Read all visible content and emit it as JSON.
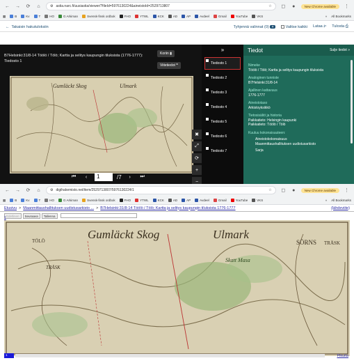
{
  "top_browser": {
    "url": "astia.narc.fi/uusiastia/viewer/?fileId=5976130224&aineistoId=2529713807",
    "new_chrome": "New Chrome available",
    "bookmarks": [
      "B",
      "Kv",
      "T",
      "HO",
      "G Arkiman",
      "Svensk-finsk ordbok",
      "FHO",
      "YTWL",
      "KCK",
      "AD",
      "AP",
      "Avdeel",
      "Gmail",
      "YouTube",
      "VKS"
    ],
    "all_bookmarks": "All Bookmarks"
  },
  "app_toolbar": {
    "back": "Takaisin hakutuloksiin",
    "clear": "Tyhjennä valinnat",
    "count": "(0)",
    "select_all": "Valitse kaikki",
    "download": "Lataa",
    "print": "Tulosta"
  },
  "viewer": {
    "title": "B7Helsinki:31/8-14 Töölö / Tölö; Kartta ja selitys kaupungin tiluksista (1776-1777): Tiedosto 1",
    "cart_btn": "Koriin",
    "cite_btn": "Viitetiedot",
    "page_current": "1",
    "page_total": "/7",
    "tools": [
      "✖",
      "⤢",
      "⟳",
      "+",
      "−"
    ]
  },
  "files": {
    "toggle": "»",
    "items": [
      "Tiedosto 1",
      "Tiedosto 2",
      "Tiedosto 3",
      "Tiedosto 4",
      "Tiedosto 5",
      "Tiedosto 6",
      "Tiedosto 7"
    ]
  },
  "info_panel": {
    "title": "Tiedot",
    "close": "Sulje tiedot",
    "name_label": "Nimeke",
    "name_value": "Töölö / Tölö; Kartta ja selitys kaupungin tiluksista",
    "id_label": "Analoginen tunniste",
    "id_value": "B7Helsinki:31/8-14",
    "time_label": "Ajallinen kattavuus",
    "time_value": "1776-1777",
    "type_label": "Aineistotaso",
    "type_value": "Arkistoyksikkö",
    "origin_label": "Tietosisältö ja historia",
    "place1": "Paikkatieto: Helsingin kaupunki",
    "place2": "Paikkatieto: Töölö / Tölö",
    "belongs_label": "Kuuluu kokonaisuuteen:",
    "belongs_a": "Aineistokokonaisuus",
    "belongs_b": "Maanmittaushallituksen uudistusarkisto",
    "belongs_c": "Sarja"
  },
  "bottom_browser": {
    "url": "digihakemisto.net/item/2529713807/5976130224/1",
    "new_chrome": "New Chrome available",
    "all_bookmarks": "All Bookmarks"
  },
  "digi": {
    "crumb_home": "Etusivu",
    "crumb_sep": ">",
    "crumb_archive": "Maanmittaushallituksen uudistusarkisto ...",
    "crumb_item": "B7Helsinki:31/8-14 Töölö / Tölö; Kartta ja selitys kaupungin tiluksista 1776-1777",
    "lahde": "(lähdeviite)",
    "btn_prev": "Edellinen",
    "btn_next": "Seuraava",
    "btn_save": "Tallenna",
    "page_link": "1",
    "bottom_num": "1",
    "sivua": "Pikuita"
  },
  "map_labels": {
    "title": "Gumläckt Skog",
    "ulmark": "Ulmark",
    "tolo": "TÖLÖ",
    "trask": "TRÄSK",
    "sorns": "SÖRNS",
    "trask2": "TRÄSK",
    "skattmasa": "Skatt Masa"
  }
}
